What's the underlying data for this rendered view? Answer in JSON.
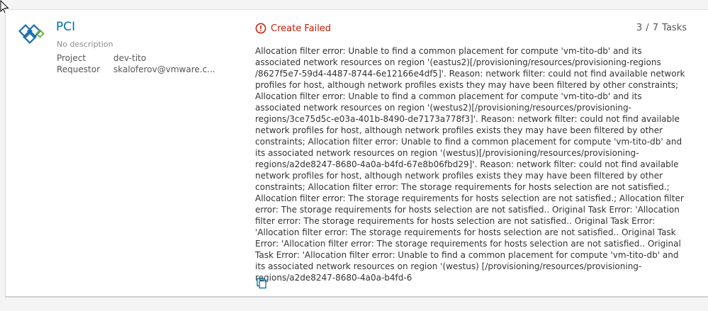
{
  "card": {
    "title": "PCI",
    "description": "No description",
    "project_label": "Project",
    "project_value": "dev-tito",
    "requestor_label": "Requestor",
    "requestor_value": "skaloferov@vmware.c..."
  },
  "status": {
    "text": "Create Failed",
    "color": "#c21d00",
    "icon": "exclamation-circle-icon"
  },
  "tasks": "3 / 7 Tasks",
  "error_message": "Allocation filter error: Unable to find a common placement for compute 'vm-tito-db' and its associated network resources on region '(eastus2)[/provisioning/resources/provisioning-regions /8627f5e7-59d4-4487-8744-6e12166e4df5]'. Reason: network filter: could not find available network profiles for host, although network profiles exists they may have been filtered by other constraints; Allocation filter error: Unable to find a common placement for compute 'vm-tito-db' and its associated network resources on region '(westus2)[/provisioning/resources/provisioning-regions/3ce75d5c-e03a-401b-8490-de7173a778f3]'. Reason: network filter: could not find available network profiles for host, although network profiles exists they may have been filtered by other constraints; Allocation filter error: Unable to find a common placement for compute 'vm-tito-db' and its associated network resources on region '(westus)[/provisioning/resources/provisioning-regions/a2de8247-8680-4a0a-b4fd-67e8b06fbd29]'. Reason: network filter: could not find available network profiles for host, although network profiles exists they may have been filtered by other constraints; Allocation filter error: The storage requirements for hosts selection are not satisfied.; Allocation filter error: The storage requirements for hosts selection are not satisfied.; Allocation filter error: The storage requirements for hosts selection are not satisfied.. Original Task Error: 'Allocation filter error: The storage requirements for hosts selection are not satisfied.. Original Task Error: 'Allocation filter error: The storage requirements for hosts selection are not satisfied.. Original Task Error: 'Allocation filter error: The storage requirements for hosts selection are not satisfied.. Original Task Error: 'Allocation filter error: Unable to find a common placement for compute 'vm-tito-db' and its associated network resources on region '(westus) [/provisioning/resources/provisioning-regions/a2de8247-8680-4a0a-b4fd-6",
  "icons": {
    "logo": "blueprint-logo-icon",
    "copy": "copy-icon",
    "cursor": "mouse-cursor-icon"
  },
  "colors": {
    "title_link": "#0072a3",
    "error": "#c21d00",
    "logo_blue": "#1c6fb0"
  }
}
